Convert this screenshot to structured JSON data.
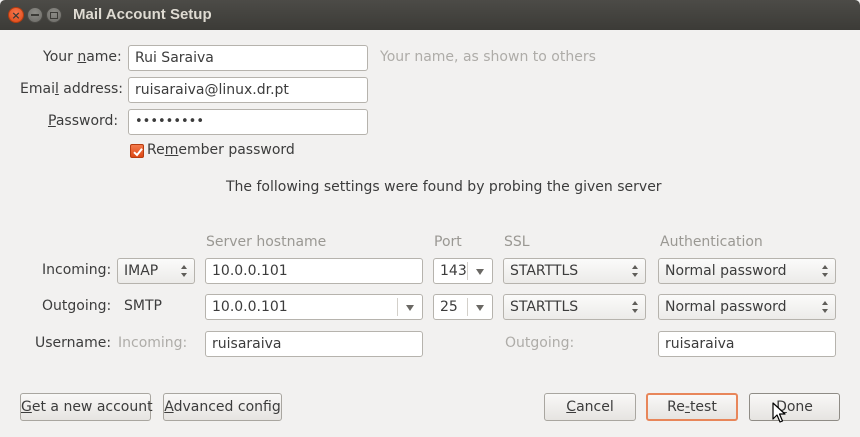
{
  "window": {
    "title": "Mail Account Setup",
    "close_glyph": "×"
  },
  "account": {
    "name_label_a": "Your ",
    "name_label_u": "n",
    "name_label_b": "ame:",
    "name_value": "Rui Saraiva",
    "name_hint": "Your name, as shown to others",
    "email_label_a": "Emai",
    "email_label_u": "l",
    "email_label_b": " address:",
    "email_value": "ruisaraiva@linux.dr.pt",
    "password_label_a": "",
    "password_label_u": "P",
    "password_label_b": "assword:",
    "password_value": "•••••••••",
    "remember_a": "Re",
    "remember_u": "m",
    "remember_b": "ember password",
    "remember_checked": true
  },
  "probe_message": "The following settings were found by probing the given server",
  "headers": {
    "server_hostname": "Server hostname",
    "port": "Port",
    "ssl": "SSL",
    "authentication": "Authentication"
  },
  "incoming": {
    "label": "Incoming:",
    "protocol": "IMAP",
    "hostname": "10.0.0.101",
    "port": "143",
    "ssl": "STARTTLS",
    "auth": "Normal password"
  },
  "outgoing": {
    "label": "Outgoing:",
    "protocol": "SMTP",
    "hostname": "10.0.0.101",
    "port": "25",
    "ssl": "STARTTLS",
    "auth": "Normal password"
  },
  "username": {
    "label": "Username:",
    "incoming_label": "Incoming:",
    "incoming_value": "ruisaraiva",
    "outgoing_label": "Outgoing:",
    "outgoing_value": "ruisaraiva"
  },
  "buttons": {
    "new_account_u": "G",
    "new_account_b": "et a new account",
    "advanced_u": "A",
    "advanced_b": "dvanced config",
    "cancel_a": "",
    "cancel_u": "C",
    "cancel_b": "ancel",
    "retest_a": "Re",
    "retest_u": "-",
    "retest_b": "test",
    "done_a": "",
    "done_u": "D",
    "done_b": "one"
  },
  "colors": {
    "accent": "#dd4814",
    "titlebar": "#3c3b37",
    "background": "#f2f1f0"
  }
}
